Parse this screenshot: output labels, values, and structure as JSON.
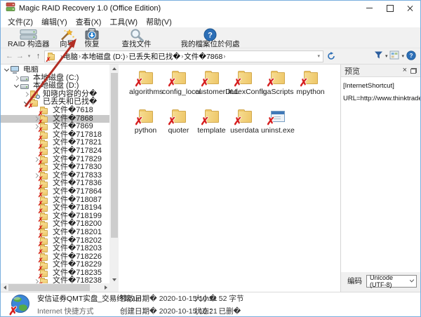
{
  "glyphs": {
    "x_mark": "✗",
    "crumb_sep": "›",
    "back_arrow": "←",
    "forward_arrow": "→",
    "up_arrow": "↑",
    "caret_down": "▾",
    "close_x": "×"
  },
  "colors": {
    "accent_blue": "#2d6fb7",
    "folder_yellow": "#eec768",
    "error_red": "#d61f1f",
    "annotation_arrow_red": "#b22e24",
    "selection_gray": "#c9c9c9"
  },
  "window": {
    "title": "Magic RAID Recovery 1.0 (Office Edition)"
  },
  "menu": {
    "items": [
      "文件(Z)",
      "编辑(Y)",
      "查看(X)",
      "工具(W)",
      "帮助(V)"
    ]
  },
  "toolbar": {
    "buttons": [
      {
        "name": "raid-builder-button",
        "icon": "raid-builder-icon",
        "label": "RAID 构造器"
      },
      {
        "name": "wizard-button",
        "icon": "wizard-wand-icon",
        "label": "向导"
      },
      {
        "name": "recover-button",
        "icon": "recover-icon",
        "label": "恢复"
      },
      {
        "name": "find-files-button",
        "icon": "search-files-icon",
        "label": "查找文件"
      },
      {
        "name": "where-are-my-files-button",
        "icon": "help-question-icon",
        "label": "我的檔案位於何處"
      }
    ]
  },
  "breadcrumb": {
    "items": [
      "电脑",
      "本地磁盘 (D:)",
      "已丢失和已找�",
      "文件�7868"
    ]
  },
  "tree": {
    "items": [
      {
        "label": "电脑",
        "depth": 0,
        "arrow": "expanded",
        "icon": "computer"
      },
      {
        "label": "本地磁盘 (C:)",
        "depth": 1,
        "arrow": "collapsed",
        "icon": "drive"
      },
      {
        "label": "本地磁盘 (D:)",
        "depth": 1,
        "arrow": "expanded",
        "icon": "drive"
      },
      {
        "label": "知晓内容的分�",
        "depth": 2,
        "arrow": "collapsed",
        "icon": "folder-search"
      },
      {
        "label": "已丢失和已找�",
        "depth": 2,
        "arrow": "expanded",
        "icon": "folder-x"
      },
      {
        "label": "文件�7618",
        "depth": 3,
        "arrow": "none",
        "icon": "folder-x"
      },
      {
        "label": "文件�7868",
        "depth": 3,
        "arrow": "collapsed",
        "icon": "folder-x",
        "selected": true
      },
      {
        "label": "文件�7869",
        "depth": 3,
        "arrow": "collapsed",
        "icon": "folder-x"
      },
      {
        "label": "文件�717818",
        "depth": 3,
        "arrow": "none",
        "icon": "folder-x"
      },
      {
        "label": "文件�717821",
        "depth": 3,
        "arrow": "none",
        "icon": "folder-x"
      },
      {
        "label": "文件�717824",
        "depth": 3,
        "arrow": "none",
        "icon": "folder-x"
      },
      {
        "label": "文件�717829",
        "depth": 3,
        "arrow": "collapsed",
        "icon": "folder-x"
      },
      {
        "label": "文件�717830",
        "depth": 3,
        "arrow": "none",
        "icon": "folder-x"
      },
      {
        "label": "文件�717833",
        "depth": 3,
        "arrow": "collapsed",
        "icon": "folder-x"
      },
      {
        "label": "文件�717836",
        "depth": 3,
        "arrow": "none",
        "icon": "folder-x"
      },
      {
        "label": "文件�717864",
        "depth": 3,
        "arrow": "none",
        "icon": "folder-x"
      },
      {
        "label": "文件�718087",
        "depth": 3,
        "arrow": "none",
        "icon": "folder-x"
      },
      {
        "label": "文件�718194",
        "depth": 3,
        "arrow": "none",
        "icon": "folder-x"
      },
      {
        "label": "文件�718199",
        "depth": 3,
        "arrow": "none",
        "icon": "folder-x"
      },
      {
        "label": "文件�718200",
        "depth": 3,
        "arrow": "none",
        "icon": "folder-x"
      },
      {
        "label": "文件�718201",
        "depth": 3,
        "arrow": "none",
        "icon": "folder-x"
      },
      {
        "label": "文件�718202",
        "depth": 3,
        "arrow": "none",
        "icon": "folder-x"
      },
      {
        "label": "文件�718203",
        "depth": 3,
        "arrow": "none",
        "icon": "folder-x"
      },
      {
        "label": "文件�718226",
        "depth": 3,
        "arrow": "none",
        "icon": "folder-x"
      },
      {
        "label": "文件�718229",
        "depth": 3,
        "arrow": "none",
        "icon": "folder-x"
      },
      {
        "label": "文件�718235",
        "depth": 3,
        "arrow": "none",
        "icon": "folder-x"
      },
      {
        "label": "文件�718238",
        "depth": 3,
        "arrow": "collapsed",
        "icon": "folder-x"
      }
    ]
  },
  "files": {
    "items": [
      {
        "name": "algorithms",
        "icon": "deleted-folder"
      },
      {
        "name": "config_local",
        "icon": "deleted-folder"
      },
      {
        "name": "customerDLL",
        "icon": "deleted-folder"
      },
      {
        "name": "indexConfig",
        "icon": "deleted-folder"
      },
      {
        "name": "luaScripts",
        "icon": "deleted-folder"
      },
      {
        "name": "mpython",
        "icon": "deleted-folder"
      },
      {
        "name": "python",
        "icon": "deleted-folder"
      },
      {
        "name": "quoter",
        "icon": "deleted-folder"
      },
      {
        "name": "template",
        "icon": "deleted-folder"
      },
      {
        "name": "userdata",
        "icon": "deleted-folder"
      },
      {
        "name": "uninst.exe",
        "icon": "deleted-exe"
      }
    ]
  },
  "preview": {
    "title": "预览",
    "lines": [
      "[InternetShortcut]",
      "URL=http://www.thinktrader.net"
    ],
    "encoding_label": "编码",
    "encoding_value": "Unicode (UTF-8)"
  },
  "statusbar": {
    "filename": "安信证券QMT实盘_交易终端.url",
    "filetype": "Internet 快捷方式",
    "modified_label": "修改日期�",
    "modified_value": "2020-10-15 10:21",
    "created_label": "创建日期�",
    "created_value": "2020-10-15 10:21",
    "size_label": "大小�",
    "size_value": "52 字节",
    "status_label": "状态：",
    "status_value": "已删�"
  }
}
